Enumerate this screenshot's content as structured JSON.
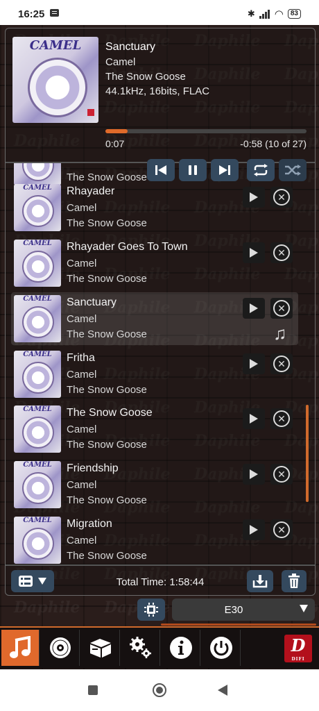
{
  "status_bar": {
    "time": "16:25",
    "battery": "83"
  },
  "now_playing": {
    "title": "Sanctuary",
    "artist": "Camel",
    "album": "The Snow Goose",
    "format": "44.1kHz, 16bits, FLAC",
    "elapsed": "0:07",
    "remaining": "-0:58",
    "position": "(10 of 27)",
    "progress_fraction": 0.11,
    "cover_text": "CAMEL"
  },
  "queue": [
    {
      "title": "",
      "artist": "",
      "album": "The Snow Goose",
      "active": false
    },
    {
      "title": "Rhayader",
      "artist": "Camel",
      "album": "The Snow Goose",
      "active": false
    },
    {
      "title": "Rhayader Goes To Town",
      "artist": "Camel",
      "album": "The Snow Goose",
      "active": false
    },
    {
      "title": "Sanctuary",
      "artist": "Camel",
      "album": "The Snow Goose",
      "active": true
    },
    {
      "title": "Fritha",
      "artist": "Camel",
      "album": "The Snow Goose",
      "active": false
    },
    {
      "title": "The Snow Goose",
      "artist": "Camel",
      "album": "The Snow Goose",
      "active": false
    },
    {
      "title": "Friendship",
      "artist": "Camel",
      "album": "The Snow Goose",
      "active": false
    },
    {
      "title": "Migration",
      "artist": "Camel",
      "album": "The Snow Goose",
      "active": false
    }
  ],
  "footer": {
    "total_time": "Total Time: 1:58:44"
  },
  "player_selector": {
    "value": "E30"
  },
  "watermark": "Daphile",
  "brand": {
    "letter": "D",
    "sub": "DIFI"
  },
  "colors": {
    "accent": "#e0692c",
    "button": "#34495e"
  }
}
